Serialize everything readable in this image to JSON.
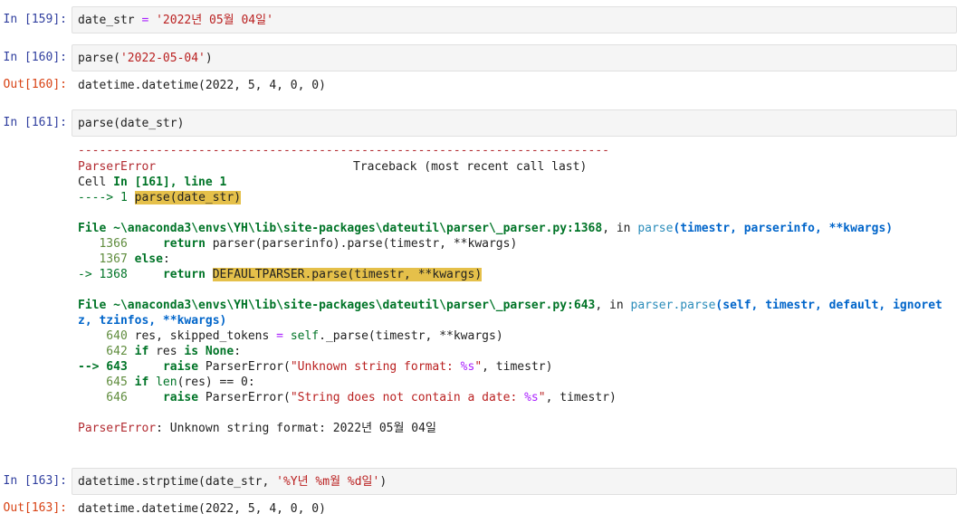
{
  "cells": [
    {
      "prompt": "In [159]:",
      "code": {
        "a": "date_str ",
        "op": "=",
        "b": " ",
        "str": "'2022년 05월 04일'"
      }
    },
    {
      "prompt": "In [160]:",
      "code": {
        "a": "parse(",
        "str": "'2022-05-04'",
        "b": ")"
      },
      "out_prompt": "Out[160]:",
      "output": "datetime.datetime(2022, 5, 4, 0, 0)"
    },
    {
      "prompt": "In [161]:",
      "code": {
        "a": "parse(date_str)"
      }
    },
    {
      "prompt": "In [163]:",
      "code": {
        "a": "datetime.strptime(date_str, ",
        "str": "'%Y년 %m월 %d일'",
        "b": ")"
      },
      "out_prompt": "Out[163]:",
      "output": "datetime.datetime(2022, 5, 4, 0, 0)"
    }
  ],
  "traceback": {
    "dashes": "---------------------------------------------------------------------------",
    "error_name": "ParserError",
    "traceback_label": "Traceback (most recent call last)",
    "cell_prefix": "Cell ",
    "cell_ref": "In [161], line 1",
    "arrow1": "----> 1 ",
    "arrow1_code": "parse(date_str)",
    "frame1_file": "File ~\\anaconda3\\envs\\YH\\lib\\site-packages\\dateutil\\parser\\_parser.py:1368",
    "frame1_in": ", in ",
    "frame1_func": "parse",
    "frame1_args": "(timestr, parserinfo, **kwargs)",
    "l1366_no": "   1366",
    "l1366_kw": "return",
    "l1366_rest": " parser(parserinfo).parse(timestr, **kwargs)",
    "l1367_no": "   1367",
    "l1367_kw": "else",
    "l1367_rest": ":",
    "l1368_arrow": "-> 1368",
    "l1368_kw": "return",
    "l1368_hl": "DEFAULTPARSER.parse(timestr, **kwargs)",
    "frame2_file": "File ~\\anaconda3\\envs\\YH\\lib\\site-packages\\dateutil\\parser\\_parser.py:643",
    "frame2_in": ", in ",
    "frame2_func": "parser.parse",
    "frame2_args_a": "(self, timestr, default, ignoret",
    "frame2_args_b": "z, tzinfos, **kwargs)",
    "l640_no": "    640",
    "l640_a": " res, skipped_tokens ",
    "l640_b": "= ",
    "l640_self": "self",
    "l640_c": "._parse(timestr, ",
    "l640_d": "**kwargs)",
    "l642_no": "    642",
    "l642_if": "if",
    "l642_a": " res ",
    "l642_is": "is",
    "l642_none": "None",
    "l642_b": ":",
    "l643_arrow": "--> 643",
    "l643_kw": "raise",
    "l643_a": " ParserError(",
    "l643_str": "\"Unknown string format: ",
    "l643_fmt": "%s",
    "l643_str2": "\"",
    "l643_b": ", timestr)",
    "l645_no": "    645",
    "l645_if": "if",
    "l645_len": "len",
    "l645_a": "(res) == 0:",
    "l646_no": "    646",
    "l646_kw": "raise",
    "l646_a": " ParserError(",
    "l646_str": "\"String does not contain a date: ",
    "l646_fmt": "%s",
    "l646_str2": "\"",
    "l646_b": ", timestr)",
    "final_name": "ParserError",
    "final_msg": ": Unknown string format: 2022년 05월 04일"
  }
}
